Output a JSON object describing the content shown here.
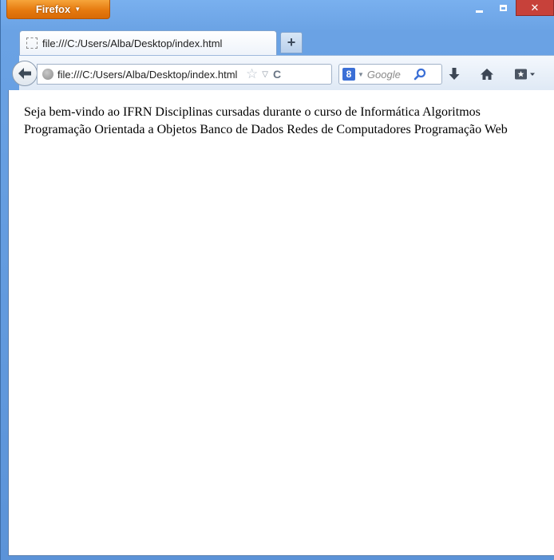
{
  "window": {
    "menu_button_label": "Firefox",
    "colors": {
      "frame": "#6aa2e4",
      "menu_button": "#e67a0f",
      "close_button": "#c7413a"
    }
  },
  "tabs": [
    {
      "title": "file:///C:/Users/Alba/Desktop/index.html",
      "active": true
    }
  ],
  "new_tab_label": "+",
  "navbar": {
    "url": "file:///C:/Users/Alba/Desktop/index.html",
    "search_engine_icon": "8",
    "search_placeholder": "Google",
    "icons": [
      "back-arrow-icon",
      "globe-icon",
      "bookmark-star-icon",
      "dropmarker-icon",
      "reload-icon",
      "google-icon",
      "magnifier-icon",
      "download-icon",
      "home-icon",
      "bookmarks-menu-icon"
    ]
  },
  "page": {
    "text": "Seja bem-vindo ao IFRN Disciplinas cursadas durante o curso de Informática Algoritmos Programação Orientada a Objetos Banco de Dados Redes de Computadores Programação Web"
  }
}
